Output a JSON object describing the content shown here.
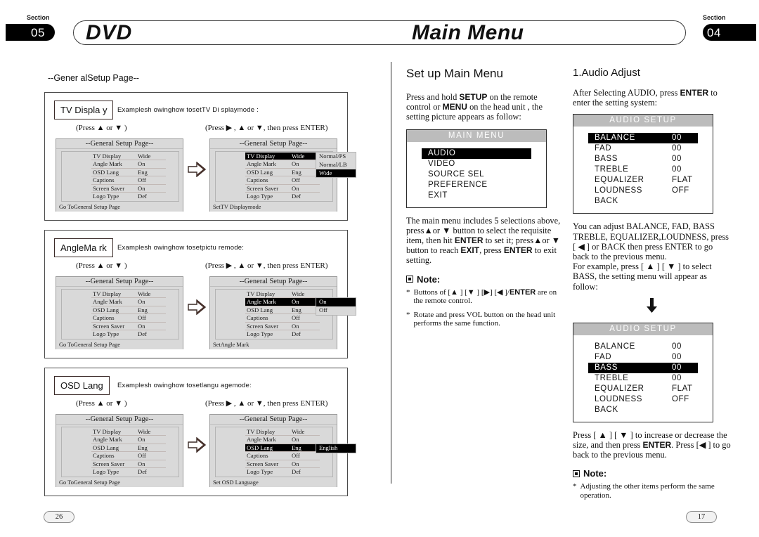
{
  "header": {
    "section_word_left": "Section",
    "section_num_left": "05",
    "title_left": "DVD",
    "title_right": "Main Menu",
    "section_word_right": "Section",
    "section_num_right": "04"
  },
  "left": {
    "caption": "--Gener alSetup Page--",
    "press_updown": "(Press ▲ or ▼ )",
    "press_right_enter": "(Press ▶ , ▲ or ▼, then press ENTER)",
    "setup_title": "--General Setup Page--",
    "foot_left": "Go ToGeneral Setup Page",
    "rows": [
      {
        "key": "TV Display",
        "val": "Wide"
      },
      {
        "key": "Angle Mark",
        "val": "On"
      },
      {
        "key": "OSD Lang",
        "val": "Eng"
      },
      {
        "key": "Captions",
        "val": "Off"
      },
      {
        "key": "Screen Saver",
        "val": "On"
      },
      {
        "key": "Logo Type",
        "val": "Def"
      }
    ],
    "panels": [
      {
        "tag": "TV Displa y",
        "desc": "Examplesh owinghow  tosetTV Di splaymode :",
        "selected_index": 0,
        "foot_right": "SetTV Displaymode",
        "options": [
          "Normal/PS",
          "Normal/LB",
          "Wide"
        ],
        "option_selected_index": 2
      },
      {
        "tag": "AngleMa rk",
        "desc": "Examplesh owinghow  tosetpictu remode:",
        "selected_index": 1,
        "foot_right": "SetAngle Mark",
        "options": [
          "On",
          "Off"
        ],
        "option_selected_index": 0
      },
      {
        "tag": "OSD Lang",
        "desc": "Examplesh owinghow  tosetlangu agemode:",
        "selected_index": 2,
        "foot_right": "Set OSD Language",
        "options": [
          "English"
        ],
        "option_selected_index": 0
      }
    ]
  },
  "middle": {
    "heading": "Set up Main Menu",
    "intro_1": "Press and hold ",
    "intro_b1": "SETUP",
    "intro_2": " on the remote control or ",
    "intro_b2": "MENU",
    "intro_3": " on the head unit , the setting picture appears as follow:",
    "main_menu": {
      "title": "MAIN MENU",
      "items": [
        "AUDIO",
        "VIDEO",
        "SOURCE SEL",
        "PREFERENCE",
        " EXIT"
      ],
      "selected_index": 0
    },
    "body_1": "The main menu includes 5 selections above, press▲or ▼ button to select the requisite item, then hit ",
    "body_b1": "ENTER",
    "body_2": " to set it; press▲or ▼ button to reach ",
    "body_b2": "EXIT",
    "body_3": ", press ",
    "body_b3": "ENTER",
    "body_4": " to exit setting.",
    "note_label": "Note:",
    "note_1_a": "Buttons of [▲ ] [▼ ] [▶] [◀ ]/",
    "note_1_b": "ENTER",
    "note_1_c": " are on the remote control.",
    "note_2": "Rotate and press VOL button on the head unit performs the same function.",
    "bullet": "*"
  },
  "right": {
    "heading": "1.Audio Adjust",
    "intro_1": "After Selecting AUDIO, press ",
    "intro_b1": "ENTER",
    "intro_2": " to enter the setting system:",
    "audio_setup_title": "AUDIO SETUP",
    "audio_rows": [
      {
        "key": "BALANCE",
        "val": "00"
      },
      {
        "key": "FAD",
        "val": "00"
      },
      {
        "key": "BASS",
        "val": "00"
      },
      {
        "key": "TREBLE",
        "val": "00"
      },
      {
        "key": "EQUALIZER",
        "val": "FLAT"
      },
      {
        "key": "LOUDNESS",
        "val": "OFF"
      },
      {
        "key": "BACK",
        "val": ""
      }
    ],
    "screen1_selected_index": 0,
    "screen2_selected_index": 2,
    "body_1": "You can adjust BALANCE, FAD, BASS TREBLE,  EQUALIZER,LOUDNESS, press [ ◀ ] or BACK then press ENTER to go back to the previous menu.",
    "body_2": "For example, press [ ▲ ] [ ▼ ] to select BASS, the setting menu will appear as follow:",
    "body_3a": "Press [ ▲ ] [ ▼ ] to increase or decrease the size, and then press ",
    "body_3b": "ENTER",
    "body_3c": ". Press [◀ ] to go back to the previous menu.",
    "note_label": "Note:",
    "note_1": "Adjusting the other items perform the same operation.",
    "bullet": "*"
  },
  "footer": {
    "page_left": "26",
    "page_right": "17"
  },
  "colors": {
    "black": "#000000",
    "osd_gray": "#d9d9d9",
    "title_bar_gray": "#bcbcbc"
  }
}
